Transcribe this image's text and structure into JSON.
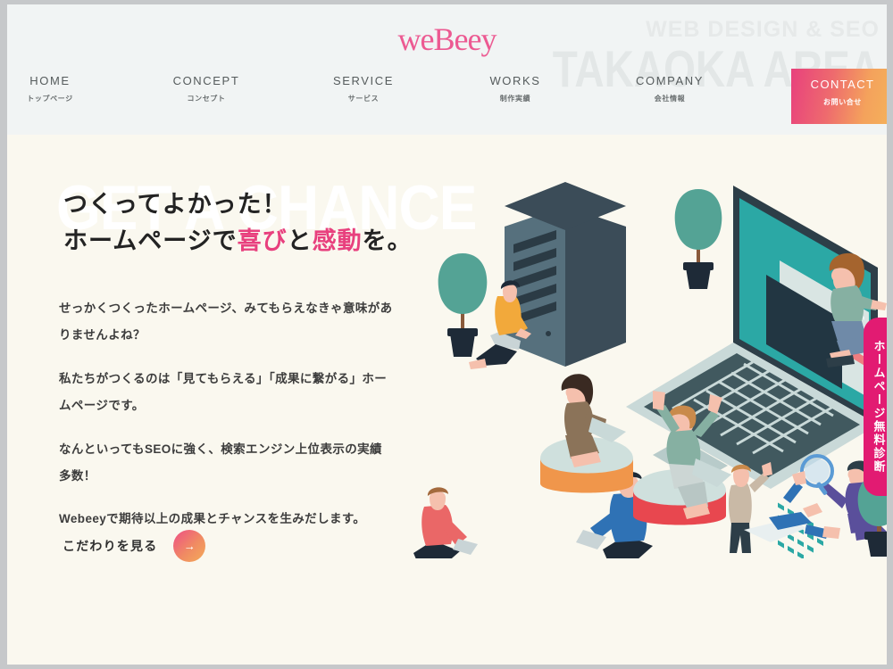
{
  "site": {
    "logo_text": "weBeey",
    "background_color": "#faf8ef",
    "header_background": "#f1f4f4",
    "accent_pink": "#e8407e",
    "accent_magenta": "#e21b72",
    "accent_orange": "#f4ab58"
  },
  "header": {
    "watermark_small": "WEB DESIGN & SEO",
    "watermark_large": "TAKAOKA AREA"
  },
  "nav": {
    "items": [
      {
        "en": "HOME",
        "jp": "トップページ"
      },
      {
        "en": "CONCEPT",
        "jp": "コンセプト"
      },
      {
        "en": "SERVICE",
        "jp": "サービス"
      },
      {
        "en": "WORKS",
        "jp": "制作実績"
      },
      {
        "en": "COMPANY",
        "jp": "会社情報"
      }
    ],
    "contact": {
      "en": "CONTACT",
      "jp": "お問い合せ"
    }
  },
  "hero": {
    "ghost_text": "GET A CHANCE",
    "headline_line1": "つくってよかった！",
    "headline_line2_pre": "ホームページで",
    "headline_accent1": "喜び",
    "headline_line2_mid": "と",
    "headline_accent2": "感動",
    "headline_line2_post": "を。",
    "paragraphs": [
      "せっかくつくったホームページ、みてもらえなきゃ意味がありませんよね？",
      "私たちがつくるのは「見てもらえる」「成果に繋がる」ホームページです。",
      "なんといってもSEOに強く、検索エンジン上位表示の実績多数！",
      "Webeeyで期待以上の成果とチャンスを生みだします。"
    ],
    "cta_label": "こだわりを見る",
    "cta_arrow": "→"
  },
  "side_tab": {
    "label": "ホームページ無料診断"
  },
  "illustration": {
    "alt": "アイソメトリックイラスト：サーバー、ノートパソコン、観葉植物、ノートPCを使う人々",
    "elements": [
      "server-tower",
      "potted-tree-left",
      "potted-tree-right",
      "potted-tree-bottom-right",
      "large-laptop",
      "code-window",
      "person-yellow-sweater",
      "person-red-sweater",
      "person-blue-sweater",
      "person-green-cheering",
      "person-brown-dress",
      "person-standing-grey",
      "person-sitting-on-laptop",
      "person-with-magnifier",
      "person-flying-blue",
      "podium-orange",
      "podium-red"
    ]
  }
}
